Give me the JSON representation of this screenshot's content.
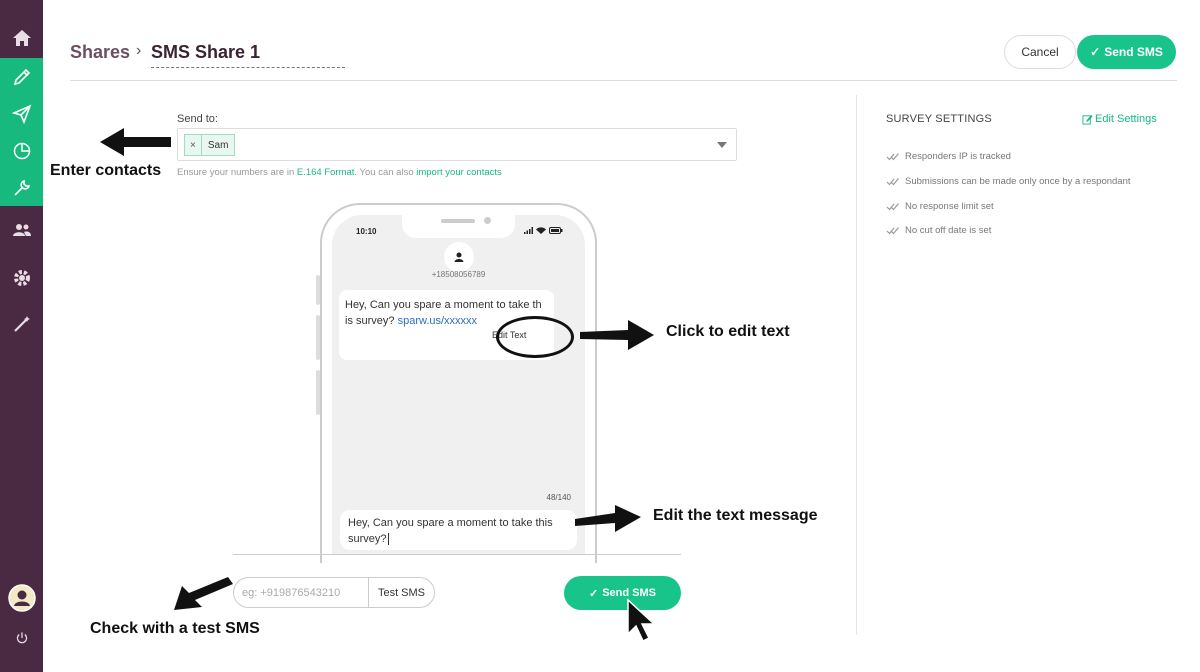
{
  "header": {
    "breadcrumb_root": "Shares",
    "breadcrumb_sep": "›",
    "title": "SMS Share 1",
    "cancel_label": "Cancel",
    "send_label": "Send SMS"
  },
  "send_to": {
    "label": "Send to:",
    "tags": [
      {
        "name": "Sam",
        "remove": "×"
      }
    ],
    "hint_prefix": "Ensure your numbers are in ",
    "hint_format": "E.164 Format.",
    "hint_middle": " You can also ",
    "hint_import": "import your contacts"
  },
  "phone": {
    "time": "10:10",
    "number": "+18508056789",
    "message_text": "Hey, Can you spare a moment to take th is survey? ",
    "message_line1": "Hey, Can you spare a moment to take th",
    "message_line2": "is survey? ",
    "message_link": "sparw.us/xxxxxx",
    "edit_text_label": "Edit Text",
    "counter": "48/140",
    "compose_line1": "Hey, Can you spare a moment to take this",
    "compose_line2": "survey?"
  },
  "test": {
    "placeholder": "eg: +919876543210",
    "button_label": "Test SMS"
  },
  "bottom_send_label": "Send SMS",
  "annotations": {
    "enter_contacts": "Enter contacts",
    "click_edit": "Click to edit text",
    "edit_message": "Edit the text message",
    "test_sms": "Check with a test SMS"
  },
  "settings": {
    "title": "SURVEY SETTINGS",
    "edit_label": "Edit Settings",
    "items": [
      "Responders IP is tracked",
      "Submissions can be made only once by a respondant",
      "No response limit set",
      "No cut off date is set"
    ]
  },
  "colors": {
    "sidebar": "#4a2a42",
    "accent": "#18c48a",
    "sidebar_active": "#18b97f"
  }
}
